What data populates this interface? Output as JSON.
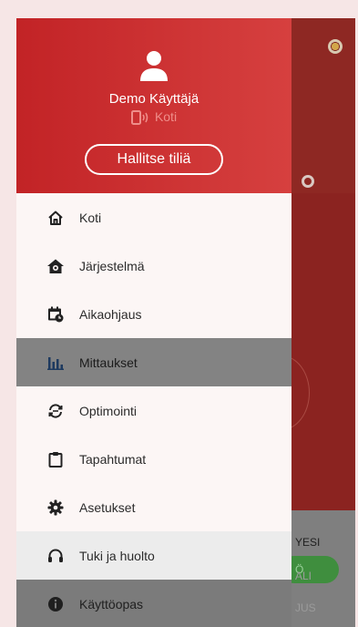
{
  "user": {
    "name": "Demo Käyttäjä",
    "home_label": "Koti",
    "manage_button": "Hallitse tiliä"
  },
  "menu": [
    {
      "label": "Koti",
      "icon": "home-icon"
    },
    {
      "label": "Järjestelmä",
      "icon": "system-icon"
    },
    {
      "label": "Aikaohjaus",
      "icon": "calendar-clock-icon"
    },
    {
      "label": "Mittaukset",
      "icon": "bar-chart-icon",
      "selected": true
    },
    {
      "label": "Optimointi",
      "icon": "optimize-icon"
    },
    {
      "label": "Tapahtumat",
      "icon": "clipboard-icon"
    },
    {
      "label": "Asetukset",
      "icon": "gear-icon"
    },
    {
      "label": "Tuki ja huolto",
      "icon": "headset-icon"
    },
    {
      "label": "Käyttöopas",
      "icon": "info-icon"
    }
  ],
  "background": {
    "label_1": "YESI",
    "pill_text": "Ö",
    "label_2": "ALI",
    "label_3": "JUS"
  },
  "colors": {
    "header_start": "#c22326",
    "header_end": "#d6403f",
    "selected_row": "#838383",
    "background_app": "#8e2823"
  }
}
